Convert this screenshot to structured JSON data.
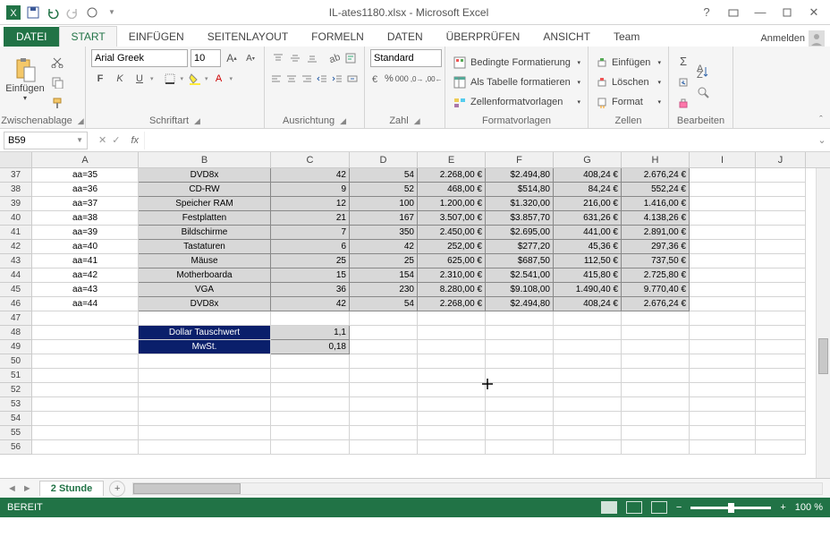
{
  "title": "IL-ates1180.xlsx - Microsoft Excel",
  "signin": "Anmelden",
  "tabs": {
    "file": "DATEI",
    "start": "START",
    "insert": "EINFÜGEN",
    "layout": "SEITENLAYOUT",
    "formulas": "FORMELN",
    "data": "DATEN",
    "review": "ÜBERPRÜFEN",
    "view": "ANSICHT",
    "team": "Team"
  },
  "ribbon": {
    "clipboard": {
      "paste": "Einfügen",
      "label": "Zwischenablage"
    },
    "font": {
      "name": "Arial Greek",
      "size": "10",
      "bold": "F",
      "italic": "K",
      "underline": "U",
      "label": "Schriftart"
    },
    "align": {
      "label": "Ausrichtung"
    },
    "number": {
      "format": "Standard",
      "label": "Zahl"
    },
    "styles": {
      "cond": "Bedingte Formatierung",
      "table": "Als Tabelle formatieren",
      "cell": "Zellenformatvorlagen",
      "label": "Formatvorlagen"
    },
    "cells": {
      "insert": "Einfügen",
      "delete": "Löschen",
      "format": "Format",
      "label": "Zellen"
    },
    "editing": {
      "label": "Bearbeiten"
    }
  },
  "namebox": "B59",
  "colHeaders": [
    "A",
    "B",
    "C",
    "D",
    "E",
    "F",
    "G",
    "H",
    "I",
    "J"
  ],
  "rows": [
    {
      "n": "37",
      "a": "aa=35",
      "b": "DVD8x",
      "c": "42",
      "d": "54",
      "e": "2.268,00 €",
      "f": "$2.494,80",
      "g": "408,24 €",
      "h": "2.676,24 €"
    },
    {
      "n": "38",
      "a": "aa=36",
      "b": "CD-RW",
      "c": "9",
      "d": "52",
      "e": "468,00 €",
      "f": "$514,80",
      "g": "84,24 €",
      "h": "552,24 €"
    },
    {
      "n": "39",
      "a": "aa=37",
      "b": "Speicher RAM",
      "c": "12",
      "d": "100",
      "e": "1.200,00 €",
      "f": "$1.320,00",
      "g": "216,00 €",
      "h": "1.416,00 €"
    },
    {
      "n": "40",
      "a": "aa=38",
      "b": "Festplatten",
      "c": "21",
      "d": "167",
      "e": "3.507,00 €",
      "f": "$3.857,70",
      "g": "631,26 €",
      "h": "4.138,26 €"
    },
    {
      "n": "41",
      "a": "aa=39",
      "b": "Bildschirme",
      "c": "7",
      "d": "350",
      "e": "2.450,00 €",
      "f": "$2.695,00",
      "g": "441,00 €",
      "h": "2.891,00 €"
    },
    {
      "n": "42",
      "a": "aa=40",
      "b": "Tastaturen",
      "c": "6",
      "d": "42",
      "e": "252,00 €",
      "f": "$277,20",
      "g": "45,36 €",
      "h": "297,36 €"
    },
    {
      "n": "43",
      "a": "aa=41",
      "b": "Mäuse",
      "c": "25",
      "d": "25",
      "e": "625,00 €",
      "f": "$687,50",
      "g": "112,50 €",
      "h": "737,50 €"
    },
    {
      "n": "44",
      "a": "aa=42",
      "b": "Motherboarda",
      "c": "15",
      "d": "154",
      "e": "2.310,00 €",
      "f": "$2.541,00",
      "g": "415,80 €",
      "h": "2.725,80 €"
    },
    {
      "n": "45",
      "a": "aa=43",
      "b": "VGA",
      "c": "36",
      "d": "230",
      "e": "8.280,00 €",
      "f": "$9.108,00",
      "g": "1.490,40 €",
      "h": "9.770,40 €"
    },
    {
      "n": "46",
      "a": "aa=44",
      "b": "DVD8x",
      "c": "42",
      "d": "54",
      "e": "2.268,00 €",
      "f": "$2.494,80",
      "g": "408,24 €",
      "h": "2.676,24 €"
    }
  ],
  "row47": {
    "n": "47"
  },
  "row48": {
    "n": "48",
    "b": "Dollar Tauschwert",
    "c": "1,1"
  },
  "row49": {
    "n": "49",
    "b": "MwSt.",
    "c": "0,18"
  },
  "emptyRows": [
    "50",
    "51",
    "52",
    "53",
    "54",
    "55",
    "56"
  ],
  "sheet": "2 Stunde",
  "status": {
    "ready": "BEREIT",
    "zoom": "100 %"
  }
}
